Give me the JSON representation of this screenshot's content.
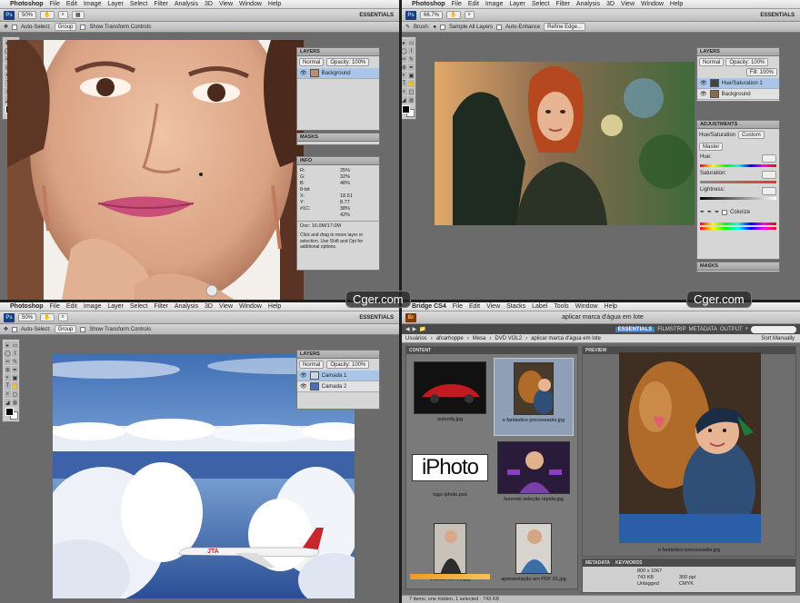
{
  "ps_menu": [
    "Photoshop",
    "File",
    "Edit",
    "Image",
    "Layer",
    "Select",
    "Filter",
    "Analysis",
    "3D",
    "View",
    "Window",
    "Help"
  ],
  "bridge_menu": [
    "Bridge CS4",
    "File",
    "Edit",
    "View",
    "Stacks",
    "Label",
    "Tools",
    "Window",
    "Help"
  ],
  "ps_logo": "Ps",
  "br_logo": "Br",
  "essentials": "ESSENTIALS",
  "q1": {
    "zoom": "50%",
    "options": {
      "auto_select": "Auto-Select:",
      "group": "Group",
      "transform": "Show Transform Controls"
    },
    "layers_title": "LAYERS",
    "blend": "Normal",
    "opacity": "Opacity: 100%",
    "layer_name": "Background",
    "masks_title": "MASKS",
    "info_title": "INFO",
    "info_values": [
      "R:",
      "25%",
      "G:",
      "32%",
      "B:",
      "48%",
      "8-bit",
      "",
      "X:",
      "18.51",
      "Y:",
      "8.77",
      "#1C:",
      "38%",
      "",
      "42%"
    ],
    "doc": "Doc: 16.0M/17.0M",
    "info_help": "Click and drag to move layer or selection. Use Shift and Opt for additional options."
  },
  "q2": {
    "zoom": "66.7%",
    "options": {
      "brush": "Brush:",
      "sample": "Sample All Layers",
      "auto": "Auto-Enhance",
      "refine": "Refine Edge..."
    },
    "layers_title": "LAYERS",
    "blend": "Normal",
    "opacity": "Opacity: 100%",
    "fill": "Fill: 100%",
    "layers": [
      "Hue/Saturation 1",
      "Background"
    ],
    "adjustments_title": "ADJUSTMENTS",
    "adj_name": "Hue/Saturation",
    "preset": "Custom",
    "channel": "Master",
    "hue": "Hue:",
    "saturation": "Saturation:",
    "lightness": "Lightness:",
    "colorize": "Colorize",
    "masks_title": "MASKS"
  },
  "q3": {
    "zoom": "50%",
    "options": {
      "auto_select": "Auto-Select:",
      "group": "Group",
      "transform": "Show Transform Controls"
    },
    "layers_title": "LAYERS",
    "blend": "Normal",
    "opacity": "Opacity: 100%",
    "layers": [
      "Camada 1",
      "Camada 2"
    ]
  },
  "q4": {
    "title": "aplicar marca d'água em lote",
    "workspaces": [
      "ESSENTIALS",
      "FILMSTRIP",
      "METADATA",
      "OUTPUT"
    ],
    "search_placeholder": "",
    "path": [
      "Usuários",
      "afcarhoppe",
      "Mesa",
      "DVD VOL2",
      "aplicar marca d'água em lote"
    ],
    "sort": "Sort Manually",
    "content_title": "CONTENT",
    "preview_title": "PREVIEW",
    "metadata_title": "METADATA",
    "keywords_title": "KEYWORDS",
    "items": [
      {
        "name": "automfy.jpg"
      },
      {
        "name": "o fantástico processador.jpg"
      },
      {
        "name": "logo iphoto.psd"
      },
      {
        "name": "fazendo seleção rápida.jpg"
      },
      {
        "name": "criando site 01.jpg"
      },
      {
        "name": "apresentação em PDF 01.jpg"
      }
    ],
    "iphoto_logo": "iPhoto",
    "preview_caption": "o fantástico processador.jpg",
    "meta_values": [
      "800 x 1067",
      "743 KB",
      "300 ppi",
      "Untagged",
      "CMYK"
    ],
    "status": "7 items, one hidden, 1 selected · 743 KB"
  },
  "watermarks": [
    "Cger.com",
    "Cger.com"
  ],
  "tool_glyphs": [
    "▸",
    "▭",
    "◯",
    "⌇",
    "✂",
    "✎",
    "⊕",
    "✒",
    "◐",
    "▣",
    "T",
    "✋",
    "⌕",
    "▢",
    "◢",
    "◍"
  ]
}
